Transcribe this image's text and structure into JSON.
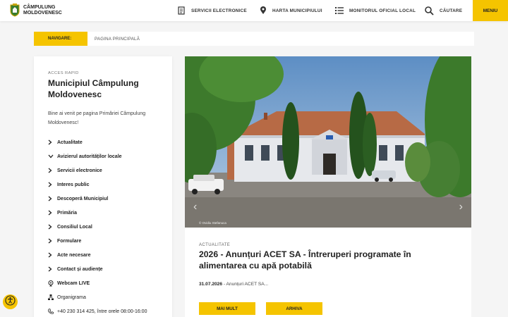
{
  "header": {
    "logo_line1": "CÂMPULUNG",
    "logo_line2": "MOLDOVENESC",
    "nav": [
      {
        "label": "SERVICII ELECTRONICE",
        "icon": "document-icon"
      },
      {
        "label": "HARTA MUNICIPIULUI",
        "icon": "map-pin-icon"
      },
      {
        "label": "MONITORUL OFICIAL LOCAL",
        "icon": "list-icon"
      },
      {
        "label": "CĂUTARE",
        "icon": "search-icon"
      }
    ],
    "menu_label": "MENIU"
  },
  "breadcrumb": {
    "label": "NAVIGARE:",
    "current": "PAGINA PRINCIPALĂ"
  },
  "sidebar": {
    "kicker": "ACCES RAPID",
    "title": "Municipiul Câmpulung Moldovenesc",
    "intro": "Bine ai venit pe pagina Primăriei Câmpulung Moldovenesc!",
    "items": [
      {
        "label": "Actualitate",
        "icon": "chevron-right-icon"
      },
      {
        "label": "Avizierul autorităților locale",
        "icon": "chevron-down-icon"
      },
      {
        "label": "Servicii electronice",
        "icon": "chevron-right-icon"
      },
      {
        "label": "Interes public",
        "icon": "chevron-right-icon"
      },
      {
        "label": "Descoperă Municipiul",
        "icon": "chevron-right-icon"
      },
      {
        "label": "Primăria",
        "icon": "chevron-right-icon"
      },
      {
        "label": "Consiliul Local",
        "icon": "chevron-right-icon"
      },
      {
        "label": "Formulare",
        "icon": "chevron-right-icon"
      },
      {
        "label": "Acte necesare",
        "icon": "chevron-right-icon"
      },
      {
        "label": "Contact și audiențe",
        "icon": "chevron-right-icon"
      },
      {
        "label": "Webcam LIVE",
        "icon": "webcam-icon"
      },
      {
        "label": "Organigrama",
        "icon": "org-chart-icon"
      },
      {
        "label": "+40 230 314 425, între orele 08:00-16:00",
        "icon": "phone-icon"
      }
    ]
  },
  "hero": {
    "credit": "© Ovidiu Stefanuca"
  },
  "article": {
    "kicker": "ACTUALITATE",
    "title": "2026 - Anunțuri ACET SA - Întreruperi programate în alimentarea cu apă potabilă",
    "date": "31.07.2026",
    "excerpt": " - Anunțuri ACET SA...",
    "more_label": "MAI MULT",
    "archive_label": "ARHIVA"
  },
  "colors": {
    "accent": "#f5c400",
    "background": "#f5f5f5"
  }
}
